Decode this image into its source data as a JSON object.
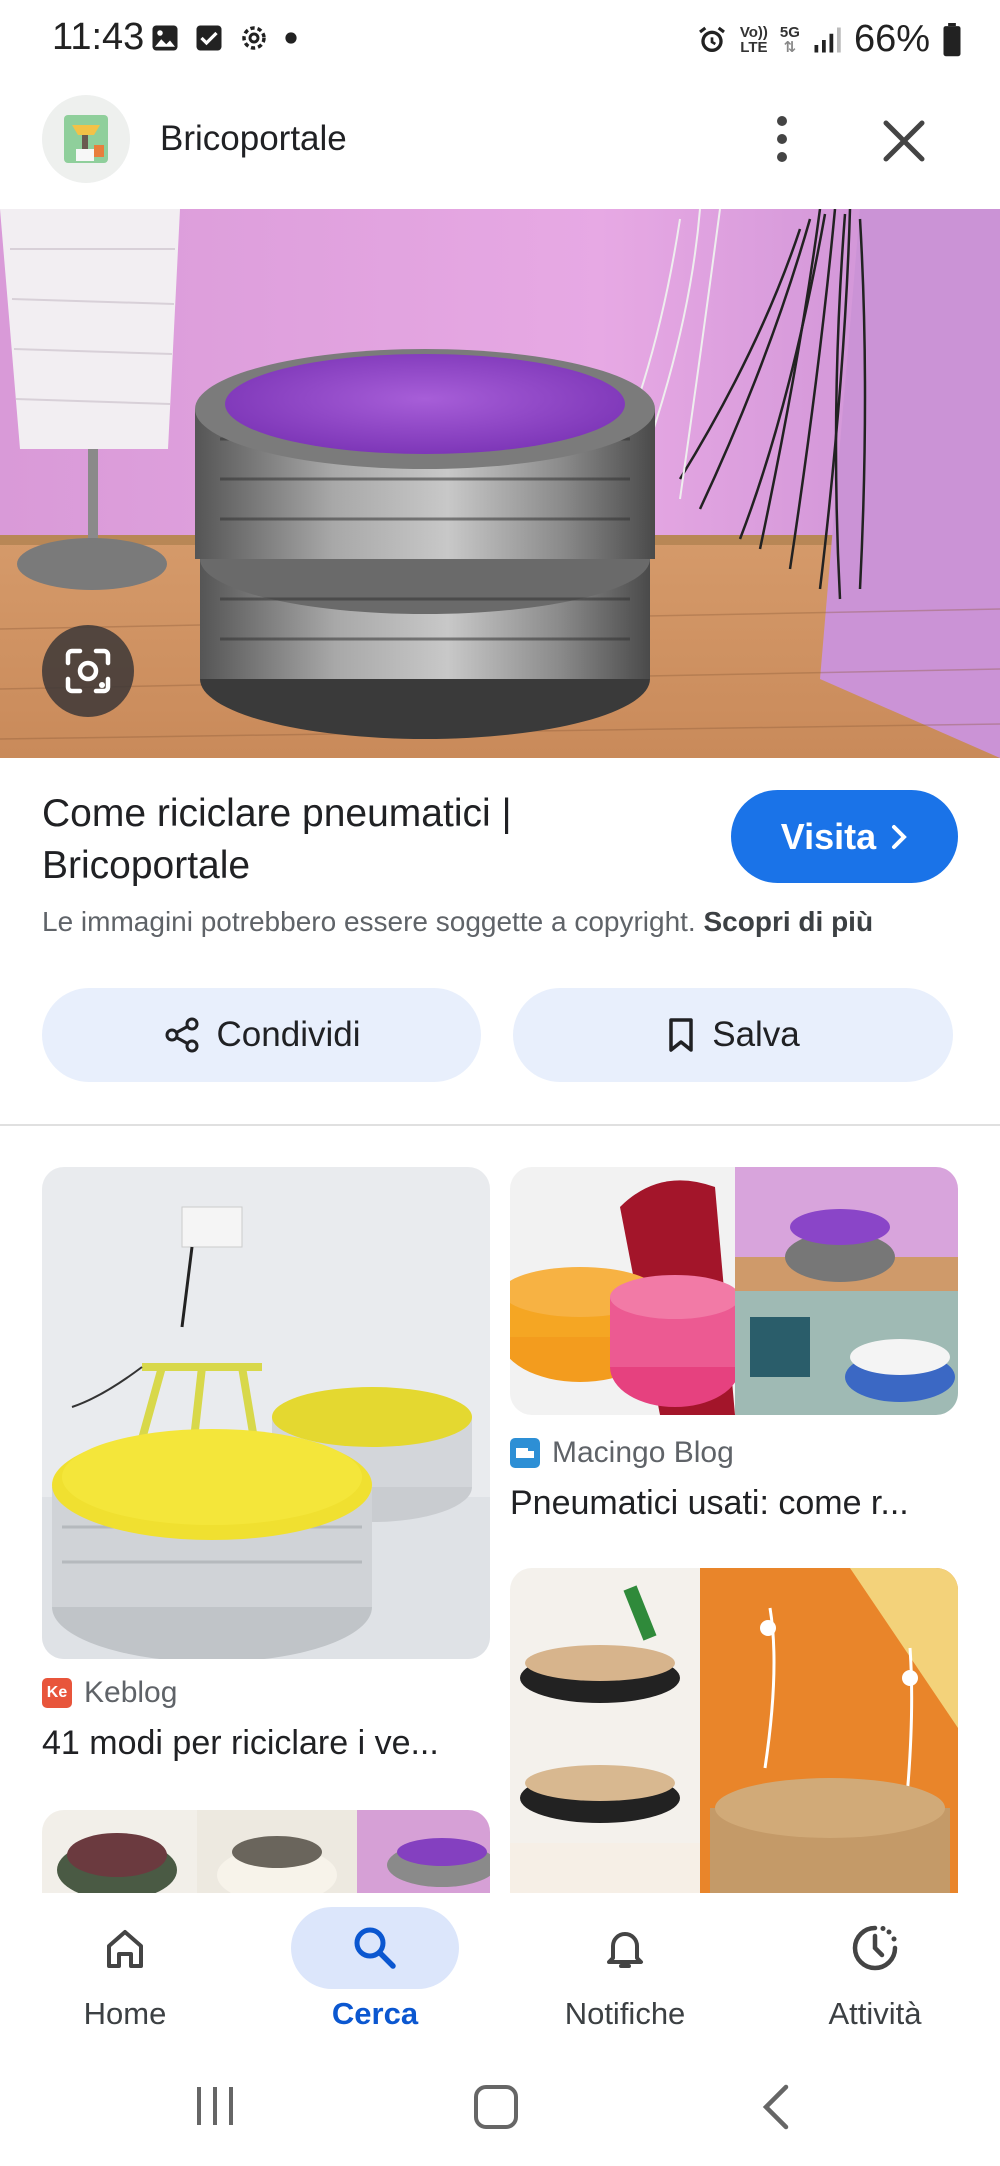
{
  "status_bar": {
    "time": "11:43",
    "volte_label_top": "Vo))",
    "volte_label_bottom": "LTE",
    "network": "5G",
    "battery": "66%"
  },
  "header": {
    "site_name": "Bricoportale",
    "icons": [
      "more-vert-icon",
      "close-icon"
    ]
  },
  "detail": {
    "title": "Come riciclare pneumatici | Bricoportale",
    "visit_label": "Visita",
    "copyright_text": "Le immagini potrebbero essere soggette a copyright.",
    "learn_more": "Scopri di più",
    "share_label": "Condividi",
    "save_label": "Salva"
  },
  "results": [
    {
      "source": "Keblog",
      "source_icon_text": "Ke",
      "title": "41 modi per riciclare i ve..."
    },
    {
      "source": "Macingo Blog",
      "source_icon_text": "",
      "title": "Pneumatici usati: come r..."
    }
  ],
  "bottom_nav": [
    {
      "label": "Home",
      "icon": "home-icon",
      "active": false
    },
    {
      "label": "Cerca",
      "icon": "search-icon",
      "active": true
    },
    {
      "label": "Notifiche",
      "icon": "bell-icon",
      "active": false
    },
    {
      "label": "Attività",
      "icon": "activity-icon",
      "active": false
    }
  ],
  "colors": {
    "accent": "#1a73e8",
    "pill_bg": "#e8effc",
    "nav_active": "#0b57d0"
  }
}
